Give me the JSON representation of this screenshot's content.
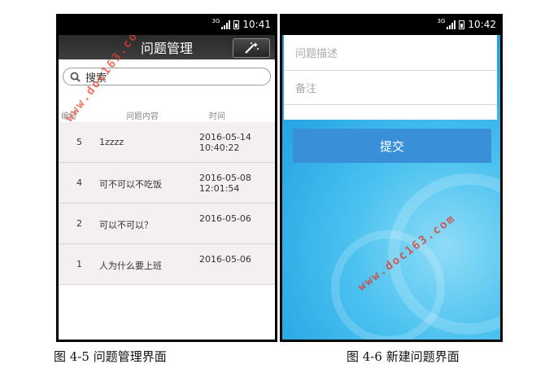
{
  "left_screen": {
    "status": {
      "network": "3G",
      "time": "10:41"
    },
    "title": "问题管理",
    "search_placeholder": "搜索",
    "columns": {
      "id": "编号",
      "content": "问题内容",
      "time": "时间"
    },
    "rows": [
      {
        "id": "5",
        "content": "1zzzz",
        "date": "2016-05-14",
        "clock": "10:40:22"
      },
      {
        "id": "4",
        "content": "可不可以不吃饭",
        "date": "2016-05-08",
        "clock": "12:01:54"
      },
      {
        "id": "2",
        "content": "可以不可以？",
        "date": "2016-05-06",
        "clock": ""
      },
      {
        "id": "1",
        "content": "人为什么要上班",
        "date": "2016-05-06",
        "clock": ""
      }
    ]
  },
  "right_screen": {
    "status": {
      "network": "3G",
      "time": "10:42"
    },
    "description_placeholder": "问题描述",
    "remark_placeholder": "备注",
    "submit_label": "提交"
  },
  "captions": {
    "left": "图 4-5  问题管理界面",
    "right": "图 4-6  新建问题界面"
  },
  "watermark": "www.doc163.com"
}
